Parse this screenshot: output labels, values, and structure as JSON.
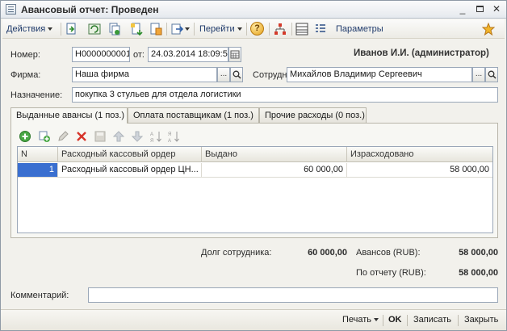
{
  "window": {
    "title": "Авансовый отчет: Проведен",
    "controls": {
      "minimize": "_",
      "close": "✕"
    }
  },
  "toolbar": {
    "actions_label": "Действия",
    "goto_label": "Перейти",
    "help_label": "?",
    "params_label": "Параметры"
  },
  "form": {
    "number_label": "Номер:",
    "number_value": "Н0000000001",
    "date_prefix": "от:",
    "date_value": "24.03.2014 18:09:54",
    "user_name": "Иванов И.И. (администратор)",
    "firm_label": "Фирма:",
    "firm_value": "Наша фирма",
    "employee_label": "Сотрудник:",
    "employee_value": "Михайлов Владимир Сергеевич",
    "purpose_label": "Назначение:",
    "purpose_value": "покупка 3 стульев для отдела логистики",
    "ellipsis": "...",
    "comment_label": "Комментарий:",
    "comment_value": ""
  },
  "tabs": [
    {
      "label": "Выданные авансы (1 поз.)",
      "active": true
    },
    {
      "label": "Оплата поставщикам (1 поз.)",
      "active": false
    },
    {
      "label": "Прочие расходы (0 поз.)",
      "active": false
    }
  ],
  "grid": {
    "columns": [
      "N",
      "Расходный кассовый ордер",
      "Выдано",
      "Израсходовано"
    ],
    "rows": [
      {
        "n": "1",
        "order": "Расходный кассовый ордер ЦН...",
        "issued": "60 000,00",
        "spent": "58 000,00"
      }
    ]
  },
  "totals": {
    "debt_label": "Долг сотрудника:",
    "debt_value": "60 000,00",
    "advances_label": "Авансов (RUB):",
    "advances_value": "58 000,00",
    "report_label": "По отчету (RUB):",
    "report_value": "58 000,00"
  },
  "bottom": {
    "print_label": "Печать",
    "ok_label": "OK",
    "save_label": "Записать",
    "close_label": "Закрыть"
  },
  "colors": {
    "selection": "#3a6fd0",
    "link_text": "#1f3a6b",
    "window_bg": "#f2f1ec"
  }
}
